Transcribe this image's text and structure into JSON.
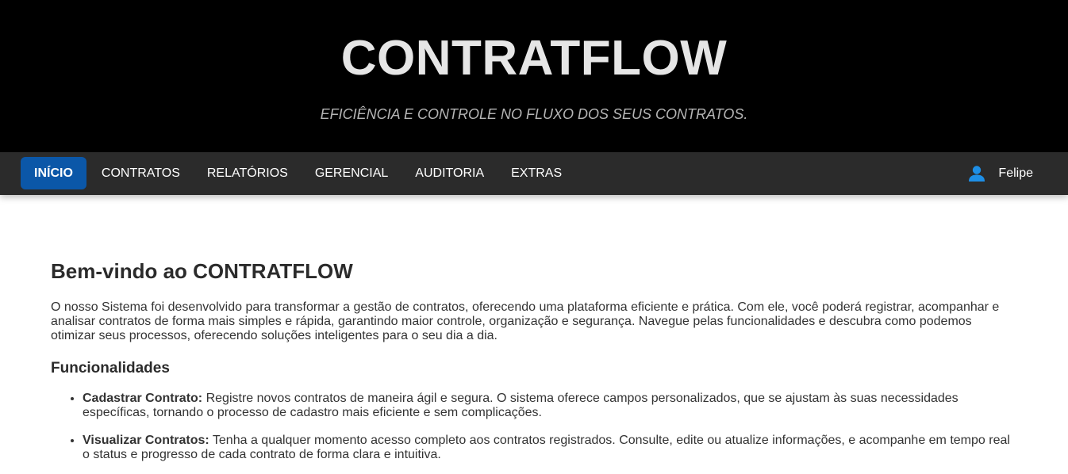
{
  "header": {
    "brand": "CONTRATFLOW",
    "tagline": "EFICIÊNCIA E CONTROLE NO FLUXO DOS SEUS CONTRATOS."
  },
  "nav": {
    "items": [
      {
        "label": "INÍCIO",
        "active": true
      },
      {
        "label": "CONTRATOS",
        "active": false
      },
      {
        "label": "RELATÓRIOS",
        "active": false
      },
      {
        "label": "GERENCIAL",
        "active": false
      },
      {
        "label": "AUDITORIA",
        "active": false
      },
      {
        "label": "EXTRAS",
        "active": false
      }
    ],
    "user": {
      "icon": "user-icon",
      "name": "Felipe"
    }
  },
  "main": {
    "title": "Bem-vindo ao CONTRATFLOW",
    "intro": "O nosso Sistema foi desenvolvido para transformar a gestão de contratos, oferecendo uma plataforma eficiente e prática. Com ele, você poderá registrar, acompanhar e analisar contratos de forma mais simples e rápida, garantindo maior controle, organização e segurança. Navegue pelas funcionalidades e descubra como podemos otimizar seus processos, oferecendo soluções inteligentes para o seu dia a dia.",
    "features_title": "Funcionalidades",
    "features": [
      {
        "name": "Cadastrar Contrato:",
        "description": "Registre novos contratos de maneira ágil e segura. O sistema oferece campos personalizados, que se ajustam às suas necessidades específicas, tornando o processo de cadastro mais eficiente e sem complicações."
      },
      {
        "name": "Visualizar Contratos:",
        "description": "Tenha a qualquer momento acesso completo aos contratos registrados. Consulte, edite ou atualize informações, e acompanhe em tempo real o status e progresso de cada contrato de forma clara e intuitiva."
      }
    ]
  },
  "colors": {
    "header_bg": "#000000",
    "navbar_bg": "#2b2b2b",
    "active_tab": "#0b57a8",
    "user_icon": "#1e8fe6"
  }
}
